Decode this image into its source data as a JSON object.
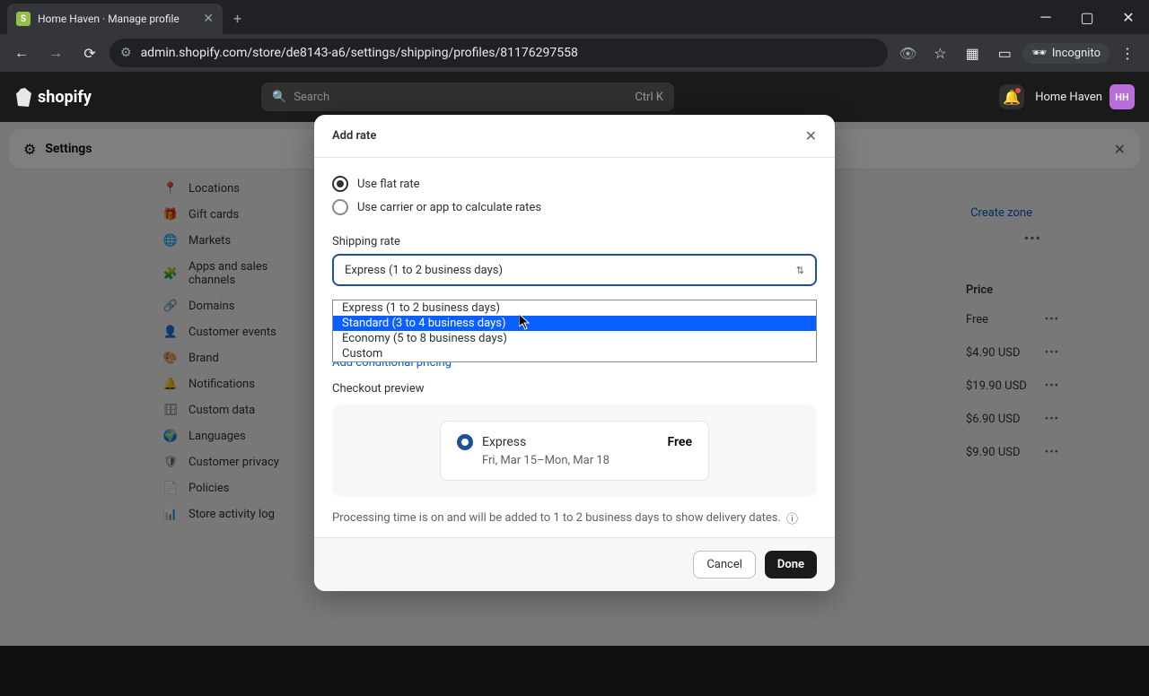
{
  "browser": {
    "tab_title": "Home Haven · Manage profile",
    "url": "admin.shopify.com/store/de8143-a6/settings/shipping/profiles/81176297558",
    "incognito_label": "Incognito"
  },
  "header": {
    "logo_text": "shopify",
    "search_placeholder": "Search",
    "search_shortcut": "Ctrl K",
    "store_name": "Home Haven",
    "store_initials": "HH"
  },
  "settings": {
    "title": "Settings"
  },
  "sidebar": {
    "items": [
      {
        "icon": "📍",
        "label": "Locations"
      },
      {
        "icon": "🎁",
        "label": "Gift cards"
      },
      {
        "icon": "🌐",
        "label": "Markets"
      },
      {
        "icon": "🧩",
        "label": "Apps and sales channels"
      },
      {
        "icon": "🔗",
        "label": "Domains"
      },
      {
        "icon": "👤",
        "label": "Customer events"
      },
      {
        "icon": "🎨",
        "label": "Brand"
      },
      {
        "icon": "🔔",
        "label": "Notifications"
      },
      {
        "icon": "🗄",
        "label": "Custom data"
      },
      {
        "icon": "🌍",
        "label": "Languages"
      },
      {
        "icon": "🛡",
        "label": "Customer privacy"
      },
      {
        "icon": "📄",
        "label": "Policies"
      },
      {
        "icon": "📊",
        "label": "Store activity log"
      }
    ]
  },
  "background": {
    "create_zone": "Create zone",
    "price_header": "Price",
    "prices": [
      "Free",
      "$4.90 USD",
      "$19.90 USD",
      "$6.90 USD",
      "$9.90 USD"
    ]
  },
  "modal": {
    "title": "Add rate",
    "radio_flat": "Use flat rate",
    "radio_carrier": "Use carrier or app to calculate rates",
    "shipping_rate_label": "Shipping rate",
    "selected_rate": "Express (1 to 2 business days)",
    "dropdown_options": [
      "Express (1 to 2 business days)",
      "Standard (3 to 4 business days)",
      "Economy (5 to 8 business days)",
      "Custom"
    ],
    "conditional_link": "Add conditional pricing",
    "preview_label": "Checkout preview",
    "preview_name": "Express",
    "preview_price": "Free",
    "preview_dates": "Fri, Mar 15–Mon, Mar 18",
    "processing_text": "Processing time is on and will be added to 1 to 2 business days to show delivery dates.",
    "cancel": "Cancel",
    "done": "Done"
  }
}
